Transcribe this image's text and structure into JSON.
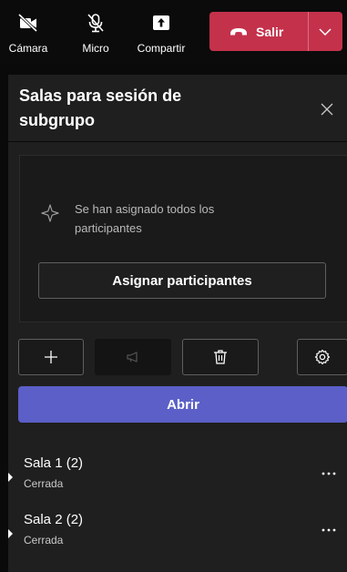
{
  "toolbar": {
    "camera_label": "Cámara",
    "mic_label": "Micro",
    "share_label": "Compartir",
    "leave_label": "Salir",
    "leave_color": "#c4314b"
  },
  "panel": {
    "title": "Salas para sesión de subgrupo",
    "assign_message": "Se han asignado todos los participantes",
    "assign_button": "Asignar participantes",
    "open_button": "Abrir",
    "accent": "#5b5fc7",
    "actions": [
      {
        "icon": "plus-icon"
      },
      {
        "icon": "megaphone-icon"
      },
      {
        "icon": "trash-icon"
      },
      {
        "icon": "gear-icon"
      }
    ],
    "rooms": [
      {
        "name": "Sala 1 (2)",
        "status": "Cerrada"
      },
      {
        "name": "Sala 2 (2)",
        "status": "Cerrada"
      }
    ]
  }
}
